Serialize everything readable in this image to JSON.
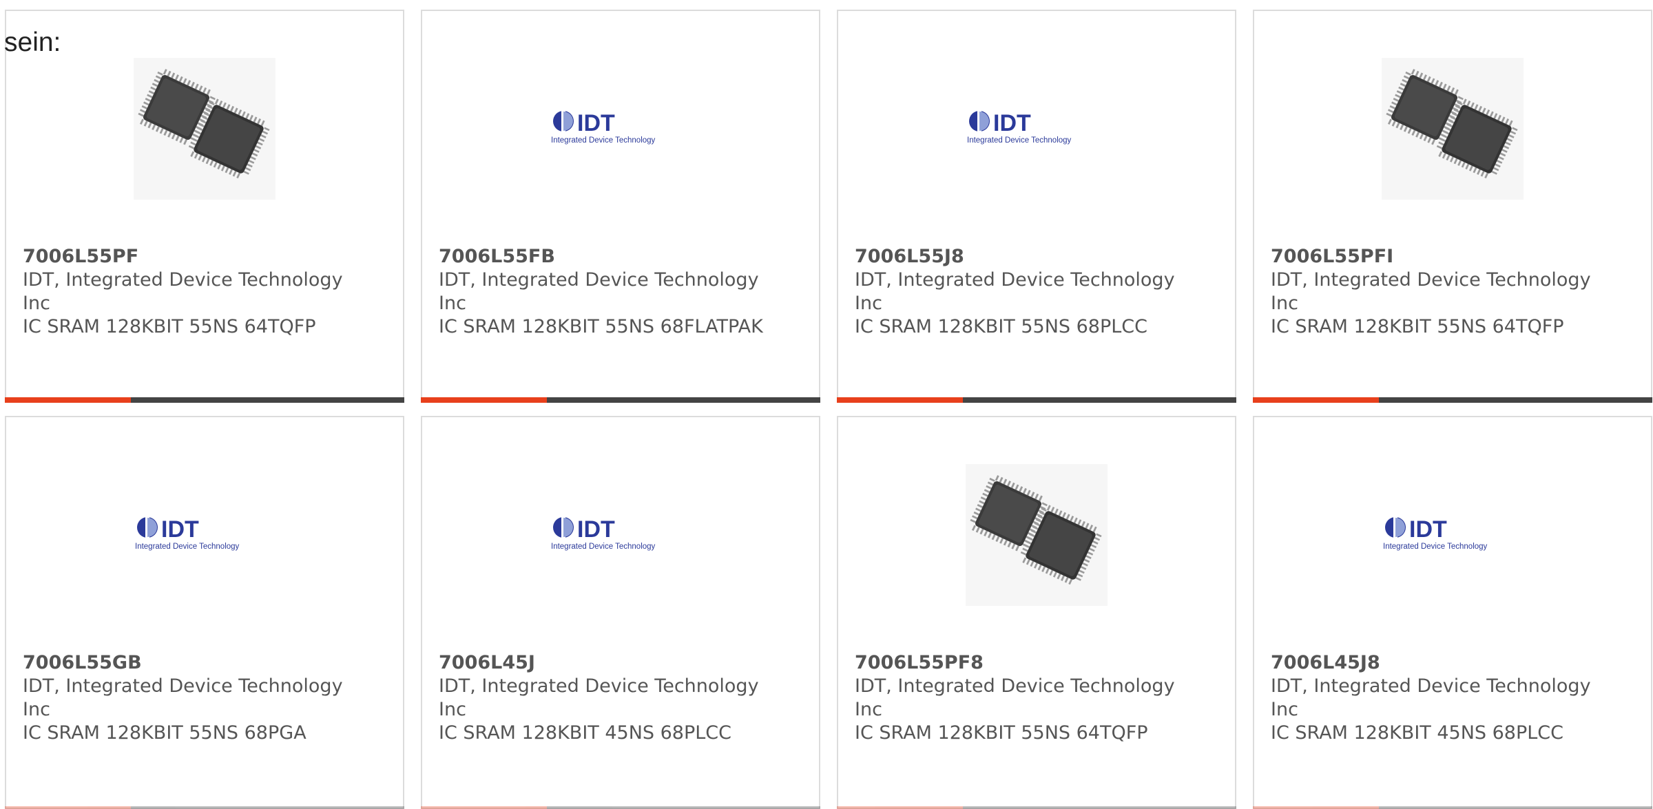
{
  "intro_text": "sein:",
  "colors": {
    "accent": "#e8401c",
    "bar_dark": "#444444",
    "idt_blue": "#2b3a9a"
  },
  "products": [
    {
      "part_number": "7006L55PF",
      "manufacturer": "IDT, Integrated Device Technology Inc",
      "description": "IC SRAM 128KBIT 55NS 64TQFP",
      "image": "chip-photo"
    },
    {
      "part_number": "7006L55FB",
      "manufacturer": "IDT, Integrated Device Technology Inc",
      "description": "IC SRAM 128KBIT 55NS 68FLATPAK",
      "image": "idt-logo"
    },
    {
      "part_number": "7006L55J8",
      "manufacturer": "IDT, Integrated Device Technology Inc",
      "description": "IC SRAM 128KBIT 55NS 68PLCC",
      "image": "idt-logo"
    },
    {
      "part_number": "7006L55PFI",
      "manufacturer": "IDT, Integrated Device Technology Inc",
      "description": "IC SRAM 128KBIT 55NS 64TQFP",
      "image": "chip-photo"
    },
    {
      "part_number": "7006L55GB",
      "manufacturer": "IDT, Integrated Device Technology Inc",
      "description": "IC SRAM 128KBIT 55NS 68PGA",
      "image": "idt-logo"
    },
    {
      "part_number": "7006L45J",
      "manufacturer": "IDT, Integrated Device Technology Inc",
      "description": "IC SRAM 128KBIT 45NS 68PLCC",
      "image": "idt-logo"
    },
    {
      "part_number": "7006L55PF8",
      "manufacturer": "IDT, Integrated Device Technology Inc",
      "description": "IC SRAM 128KBIT 55NS 64TQFP",
      "image": "chip-photo"
    },
    {
      "part_number": "7006L45J8",
      "manufacturer": "IDT, Integrated Device Technology Inc",
      "description": "IC SRAM 128KBIT 45NS 68PLCC",
      "image": "idt-logo"
    }
  ],
  "logo": {
    "brand": "IDT",
    "tagline": "Integrated Device Technology"
  }
}
